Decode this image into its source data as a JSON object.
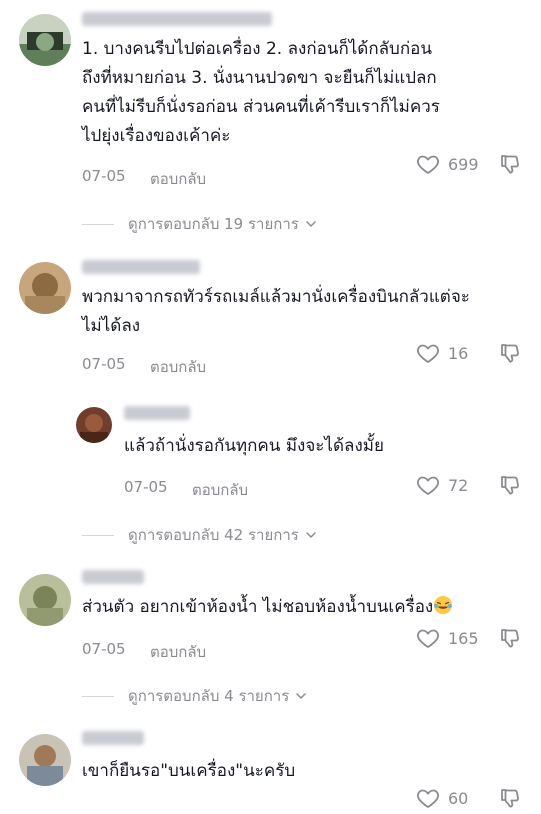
{
  "comments": [
    {
      "lines": [
        "1. บางคนรีบไปต่อเครื่อง 2. ลงก่อนก็ได้กลับก่อน",
        "ถึงที่หมายก่อน 3. นั่งนานปวดขา จะยืนก็ไม่แปลก",
        "คนที่ไม่รีบก็นั่งรอก่อน ส่วนคนที่เค้ารีบเราก็ไม่ควร",
        "ไปยุ่งเรื่องของเค้าค่ะ"
      ],
      "date": "07-05",
      "reply": "ตอบกลับ",
      "likes": "699"
    },
    {
      "lines": [
        "พวกมาจากรถทัวร์รถเมล์แล้วมานั่งเครื่องบินกลัวแต่จะ",
        "ไม่ได้ลง"
      ],
      "date": "07-05",
      "reply": "ตอบกลับ",
      "likes": "16"
    },
    {
      "lines": [
        "แล้วถ้านั่งรอกันทุกคน มึงจะได้ลงมั้ย"
      ],
      "date": "07-05",
      "reply": "ตอบกลับ",
      "likes": "72"
    },
    {
      "lines": [
        "ส่วนตัว อยากเข้าห้องน้ำ ไม่ชอบห้องน้ำบนเครื่อง"
      ],
      "date": "07-05",
      "reply": "ตอบกลับ",
      "likes": "165"
    },
    {
      "lines": [
        "เขาก็ยืนรอ\"บนเครื่อง\"นะครับ"
      ],
      "likes": "60"
    }
  ],
  "view_replies": [
    {
      "label": "ดูการตอบกลับ 19 รายการ"
    },
    {
      "label": "ดูการตอบกลับ 42 รายการ"
    },
    {
      "label": "ดูการตอบกลับ 4 รายการ"
    }
  ],
  "icons": {
    "like": "heart-outline-icon",
    "dislike": "thumbs-down-icon",
    "expand": "chevron-down-icon",
    "emoji": "tears-of-joy-emoji"
  },
  "colors": {
    "text": "#161823",
    "muted": "#8a8b91"
  }
}
